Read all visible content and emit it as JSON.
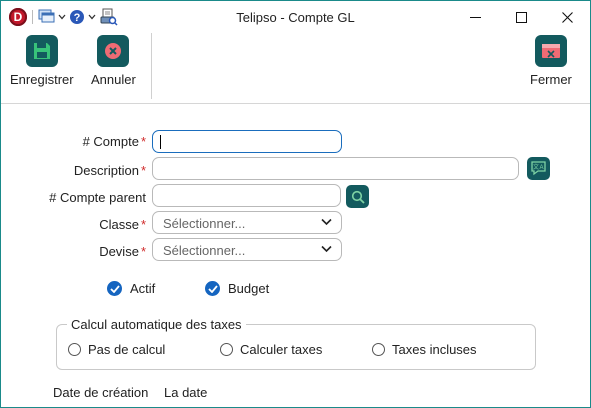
{
  "window": {
    "title": "Telipso - Compte GL"
  },
  "titlebar": {
    "logo_letter": "D",
    "quick_access_icons": [
      "app-logo-icon",
      "window-stack-icon",
      "chevron-down-icon",
      "help-icon",
      "chevron-down-icon",
      "print-preview-icon"
    ],
    "controls": [
      "minimize",
      "maximize",
      "close"
    ]
  },
  "toolbar": {
    "save_label": "Enregistrer",
    "cancel_label": "Annuler",
    "close_label": "Fermer"
  },
  "form": {
    "account_number": {
      "label": "# Compte",
      "required": true,
      "value": ""
    },
    "description": {
      "label": "Description",
      "required": true,
      "value": ""
    },
    "parent_account": {
      "label": "# Compte parent",
      "required": false,
      "value": ""
    },
    "class": {
      "label": "Classe",
      "required": true,
      "selected": "Sélectionner..."
    },
    "currency": {
      "label": "Devise",
      "required": true,
      "selected": "Sélectionner..."
    },
    "required_marker": "*"
  },
  "checkboxes": {
    "active": {
      "label": "Actif",
      "checked": true
    },
    "budget": {
      "label": "Budget",
      "checked": true
    }
  },
  "tax_group": {
    "title": "Calcul automatique des taxes",
    "options": [
      "Pas de calcul",
      "Calculer taxes",
      "Taxes incluses"
    ],
    "selected": null
  },
  "footer": {
    "creation_date_label": "Date de création",
    "creation_date_value": "La date"
  },
  "colors": {
    "accent_teal": "#135a5e",
    "focus_blue": "#1a6dbd",
    "required_red": "#d02a2a",
    "checkbox_blue": "#1565c0"
  }
}
